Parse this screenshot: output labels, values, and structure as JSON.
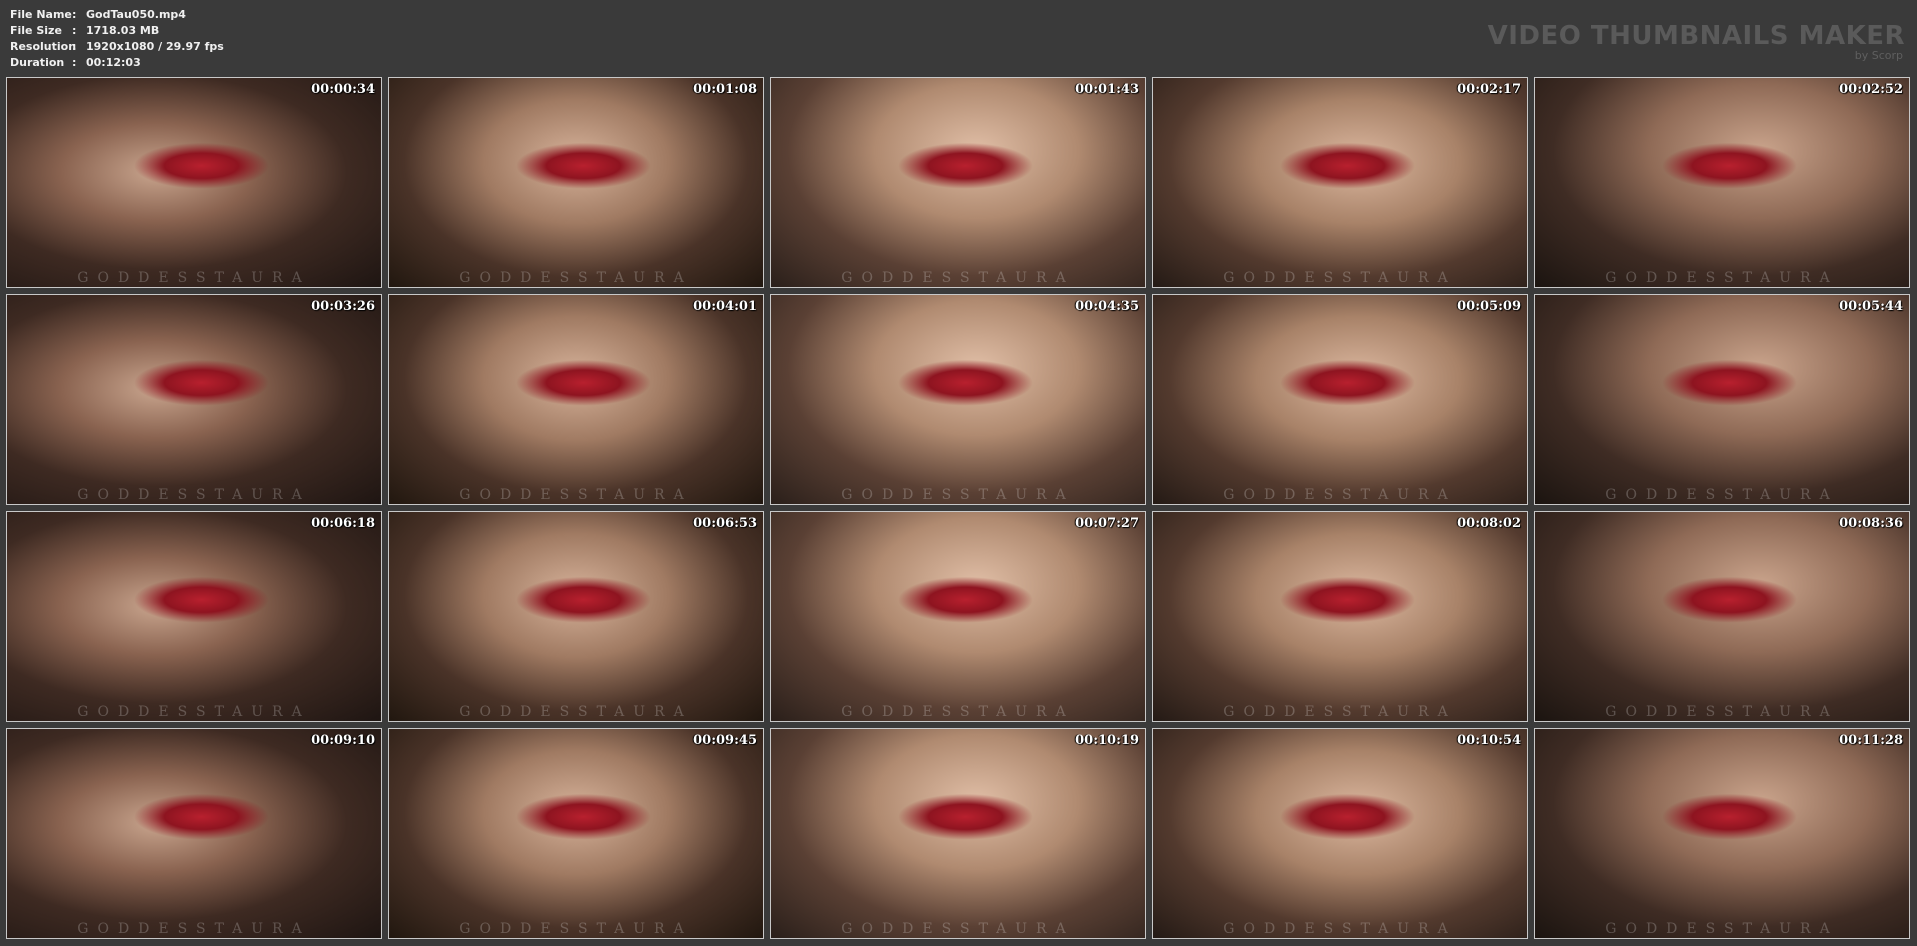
{
  "file_info": {
    "rows": [
      {
        "key": "File Name",
        "sep": ":",
        "value": "GodTau050.mp4"
      },
      {
        "key": "File Size",
        "sep": ":",
        "value": "1718.03 MB"
      },
      {
        "key": "Resolution",
        "sep": ":",
        "value": "1920x1080 / 29.97 fps"
      },
      {
        "key": "Duration",
        "sep": ":",
        "value": "00:12:03"
      }
    ]
  },
  "brand": {
    "title": "VIDEO THUMBNAILS MAKER",
    "subtitle": "by Scorp"
  },
  "watermark": "GODDESSTAURA",
  "thumbnails": [
    {
      "time": "00:00:34"
    },
    {
      "time": "00:01:08"
    },
    {
      "time": "00:01:43"
    },
    {
      "time": "00:02:17"
    },
    {
      "time": "00:02:52"
    },
    {
      "time": "00:03:26"
    },
    {
      "time": "00:04:01"
    },
    {
      "time": "00:04:35"
    },
    {
      "time": "00:05:09"
    },
    {
      "time": "00:05:44"
    },
    {
      "time": "00:06:18"
    },
    {
      "time": "00:06:53"
    },
    {
      "time": "00:07:27"
    },
    {
      "time": "00:08:02"
    },
    {
      "time": "00:08:36"
    },
    {
      "time": "00:09:10"
    },
    {
      "time": "00:09:45"
    },
    {
      "time": "00:10:19"
    },
    {
      "time": "00:10:54"
    },
    {
      "time": "00:11:28"
    }
  ],
  "colors": {
    "background": "#3a3a3a",
    "text": "#f0f0f0",
    "brand": "#5a5a5a",
    "frame_border": "#c8c8c8"
  }
}
